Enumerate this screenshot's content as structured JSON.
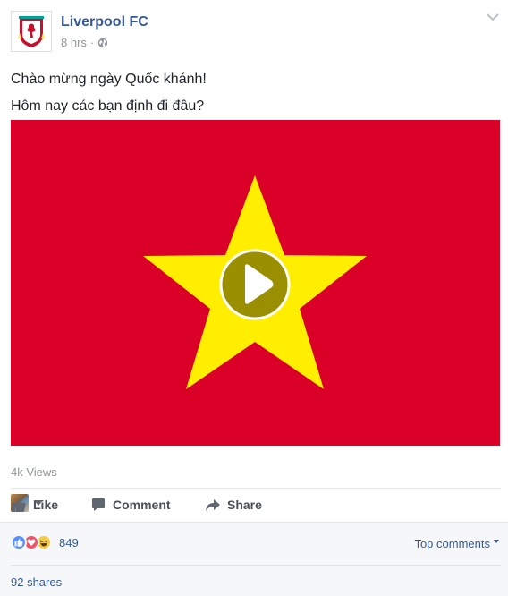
{
  "post": {
    "page_name": "Liverpool FC",
    "time": "8 hrs",
    "dot": "·",
    "audience_icon": "globe-icon",
    "menu_icon": "chevron-down-icon",
    "text_lines": [
      "Chào mừng ngày Quốc khánh!",
      "Hôm nay các bạn định đi đâu?"
    ],
    "video": {
      "background_color": "#da0028",
      "star_color": "#ffee00",
      "play_button_color": "#9a8f00",
      "play_icon": "play-icon"
    },
    "views": "4k Views"
  },
  "actions": {
    "like_label": "Like",
    "comment_label": "Comment",
    "share_label": "Share",
    "like_icon": "thumbs-up-icon",
    "comment_icon": "comment-bubble-icon",
    "share_icon": "share-arrow-icon"
  },
  "footer": {
    "reaction_icons": [
      "like-reaction-icon",
      "love-reaction-icon",
      "haha-reaction-icon"
    ],
    "reaction_count": "849",
    "top_comments_label": "Top comments",
    "shares_label": "92 shares"
  }
}
